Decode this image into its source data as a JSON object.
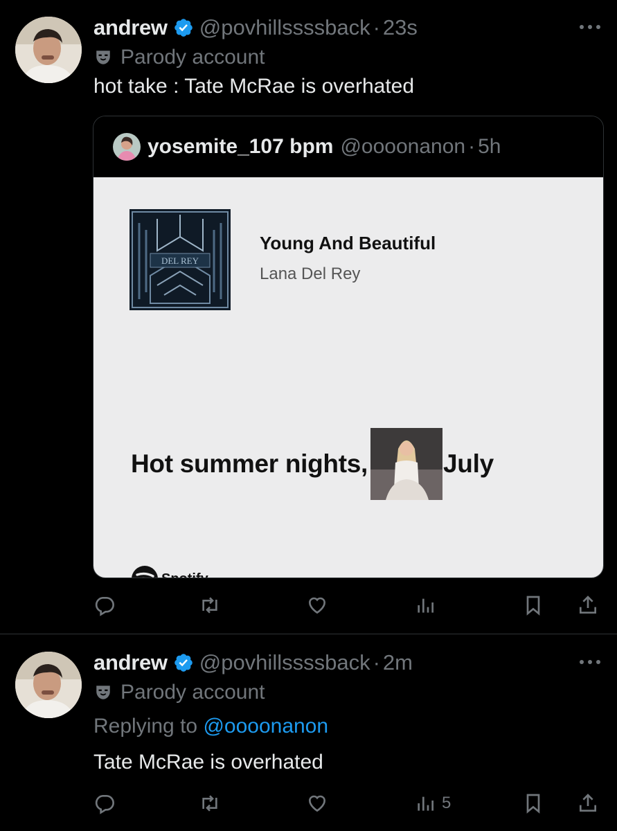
{
  "tweets": [
    {
      "author_name": "andrew",
      "handle": "@povhillssssback",
      "separator": "·",
      "time": "23s",
      "label": "Parody account",
      "text": "hot take : Tate McRae is overhated",
      "quote": {
        "author_name": "yosemite_107 bpm",
        "handle": "@oooonanon",
        "separator": "·",
        "time": "5h",
        "song_title": "Young And Beautiful",
        "song_artist": "Lana Del Rey",
        "album_text": "DEL REY",
        "lyric_before": "Hot summer nights,",
        "lyric_after": "July",
        "brand": "Spotify"
      },
      "actions": {
        "views_count": ""
      }
    },
    {
      "author_name": "andrew",
      "handle": "@povhillssssback",
      "separator": "·",
      "time": "2m",
      "label": "Parody account",
      "replying_prefix": "Replying to",
      "replying_to": "@oooonanon",
      "text": "Tate McRae is overhated",
      "actions": {
        "views_count": "5"
      }
    }
  ],
  "icons": [
    "verified-badge-icon",
    "parody-mask-icon",
    "more-icon",
    "reply-icon",
    "retweet-icon",
    "like-icon",
    "views-icon",
    "bookmark-icon",
    "share-icon",
    "spotify-logo-icon"
  ],
  "colors": {
    "background": "#000000",
    "text": "#e7e9ea",
    "secondary": "#71767b",
    "accent": "#1d9bf0",
    "card": "#ececed"
  }
}
